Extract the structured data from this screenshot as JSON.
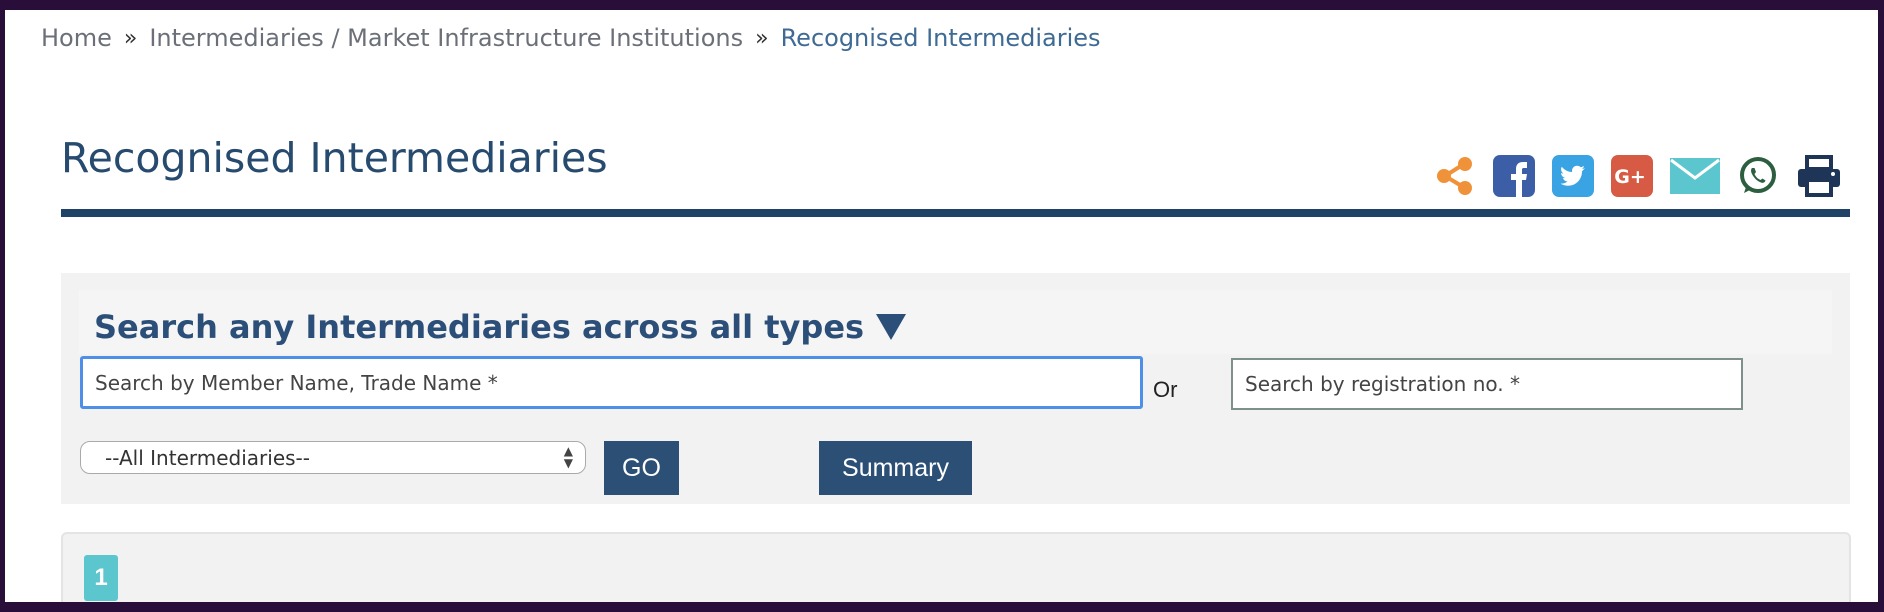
{
  "breadcrumb": {
    "items": [
      {
        "label": "Home"
      },
      {
        "label": "Intermediaries / Market Infrastructure Institutions"
      },
      {
        "label": "Recognised Intermediaries"
      }
    ],
    "separator": "»"
  },
  "page": {
    "title": "Recognised Intermediaries"
  },
  "share_bar": {
    "icons": [
      "share-icon",
      "facebook-icon",
      "twitter-icon",
      "google-plus-icon",
      "email-icon",
      "whatsapp-icon",
      "print-icon"
    ],
    "colors": {
      "share": "#f0923a",
      "facebook": "#3b5ea6",
      "twitter": "#3aa3e3",
      "google_plus": "#d75a44",
      "email": "#5cc6ce",
      "whatsapp": "#2c5e3f",
      "print": "#1f3557"
    }
  },
  "search": {
    "heading": "Search any Intermediaries across all types",
    "name_placeholder": "Search by Member Name, Trade Name *",
    "or_label": "Or",
    "reg_placeholder": "Search by registration no. *",
    "type_select_value": "--All Intermediaries--",
    "go_label": "GO",
    "summary_label": "Summary"
  },
  "results": {
    "current_page": "1"
  },
  "colors": {
    "primary": "#2c4f76",
    "rule": "#1f4266",
    "accent": "#5cc6ce",
    "frame": "#2a0e3a"
  }
}
